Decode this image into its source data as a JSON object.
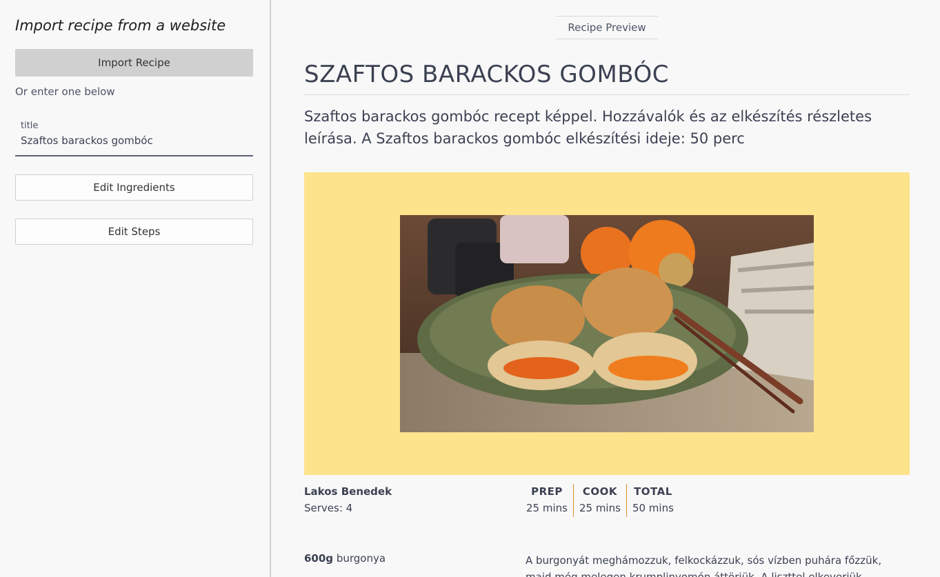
{
  "sidebar": {
    "heading": "Import recipe from a website",
    "import_button": "Import Recipe",
    "or_text": "Or enter one below",
    "title_field": {
      "label": "title",
      "value": "Szaftos barackos gombóc"
    },
    "edit_ingredients": "Edit Ingredients",
    "edit_steps": "Edit Steps"
  },
  "main": {
    "tab": "Recipe Preview",
    "title": "SZAFTOS BARACKOS GOMBÓC",
    "description": "Szaftos barackos gombóc recept képpel. Hozzávalók és az elkészítés részletes leírása. A Szaftos barackos gombóc elkészítési ideje: 50 perc",
    "author": "Lakos Benedek",
    "serves": "Serves: 4",
    "times": [
      {
        "label": "PREP",
        "value": "25 mins"
      },
      {
        "label": "COOK",
        "value": "25 mins"
      },
      {
        "label": "TOTAL",
        "value": "50 mins"
      }
    ],
    "ingredients": [
      {
        "amount": "600g",
        "name": "burgonya"
      }
    ],
    "steps": [
      "A burgonyát meghámozzuk, felkockázzuk, sós vízben puhára főzzük, majd még melegen krumplinyomón áttörjük. A liszttel elkeverjük majd"
    ]
  },
  "colors": {
    "hero_background": "#fde38b",
    "time_divider": "#e28a2b",
    "import_button": "#d0d0d0"
  }
}
